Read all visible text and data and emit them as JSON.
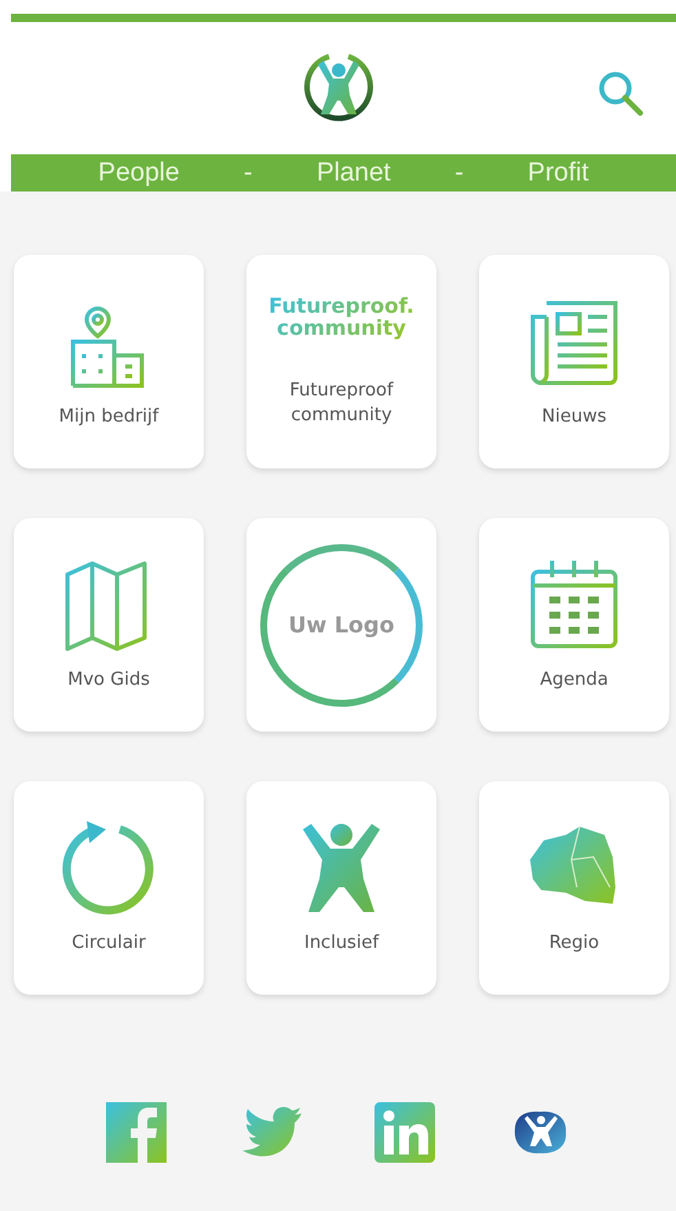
{
  "header": {
    "tagline": [
      "People",
      "-",
      "Planet",
      "-",
      "Profit"
    ]
  },
  "tiles": [
    {
      "kind": "building",
      "label": "Mijn bedrijf"
    },
    {
      "kind": "logo_text",
      "logo": [
        "Futureproof.",
        "community"
      ],
      "label": "Futureproof community"
    },
    {
      "kind": "newspaper",
      "label": "Nieuws"
    },
    {
      "kind": "map",
      "label": "Mvo Gids"
    },
    {
      "kind": "circle_logo",
      "label": "Uw Logo"
    },
    {
      "kind": "calendar",
      "label": "Agenda"
    },
    {
      "kind": "cycle",
      "label": "Circulair"
    },
    {
      "kind": "figure",
      "label": "Inclusief"
    },
    {
      "kind": "region",
      "label": "Regio"
    }
  ],
  "social": [
    {
      "kind": "facebook"
    },
    {
      "kind": "twitter"
    },
    {
      "kind": "linkedin"
    },
    {
      "kind": "app"
    }
  ]
}
